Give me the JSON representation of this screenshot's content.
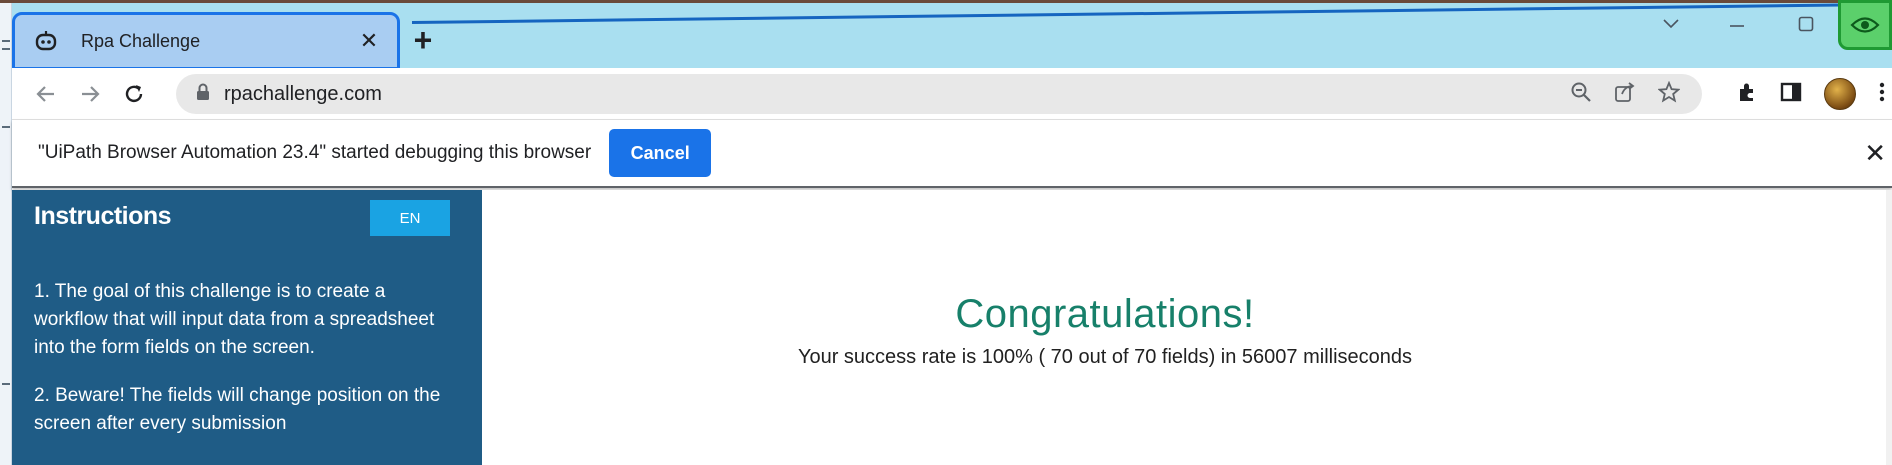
{
  "browser": {
    "tab": {
      "title": "Rpa Challenge",
      "close_glyph": "✕",
      "icon": "robot-icon"
    },
    "new_tab_glyph": "+",
    "address": {
      "url": "rpachallenge.com",
      "icon": "lock-icon"
    },
    "toolbar_icons": [
      "back-icon",
      "forward-icon",
      "reload-icon",
      "zoom-out-icon",
      "share-icon",
      "bookmark-star-icon",
      "extensions-icon",
      "side-panel-icon",
      "profile-avatar",
      "menu-icon"
    ]
  },
  "infobar": {
    "message": "\"UiPath Browser Automation 23.4\" started debugging this browser",
    "cancel_label": "Cancel",
    "close_glyph": "✕"
  },
  "sidebar": {
    "title": "Instructions",
    "language_button": "EN",
    "items": [
      "1. The goal of this challenge is to create a workflow that will input data from a spreadsheet into the form fields on the screen.",
      "2. Beware! The fields will change position on the screen after every submission"
    ]
  },
  "main": {
    "heading": "Congratulations!",
    "result_text": "Your success rate is 100% ( 70 out of 70 fields) in 56007 milliseconds"
  },
  "colors": {
    "tabstrip": "#a9dff0",
    "accent": "#1a73e8",
    "sidebar_bg": "#1f5c86",
    "heading": "#17806a",
    "lang_button": "#1aa3e3"
  }
}
